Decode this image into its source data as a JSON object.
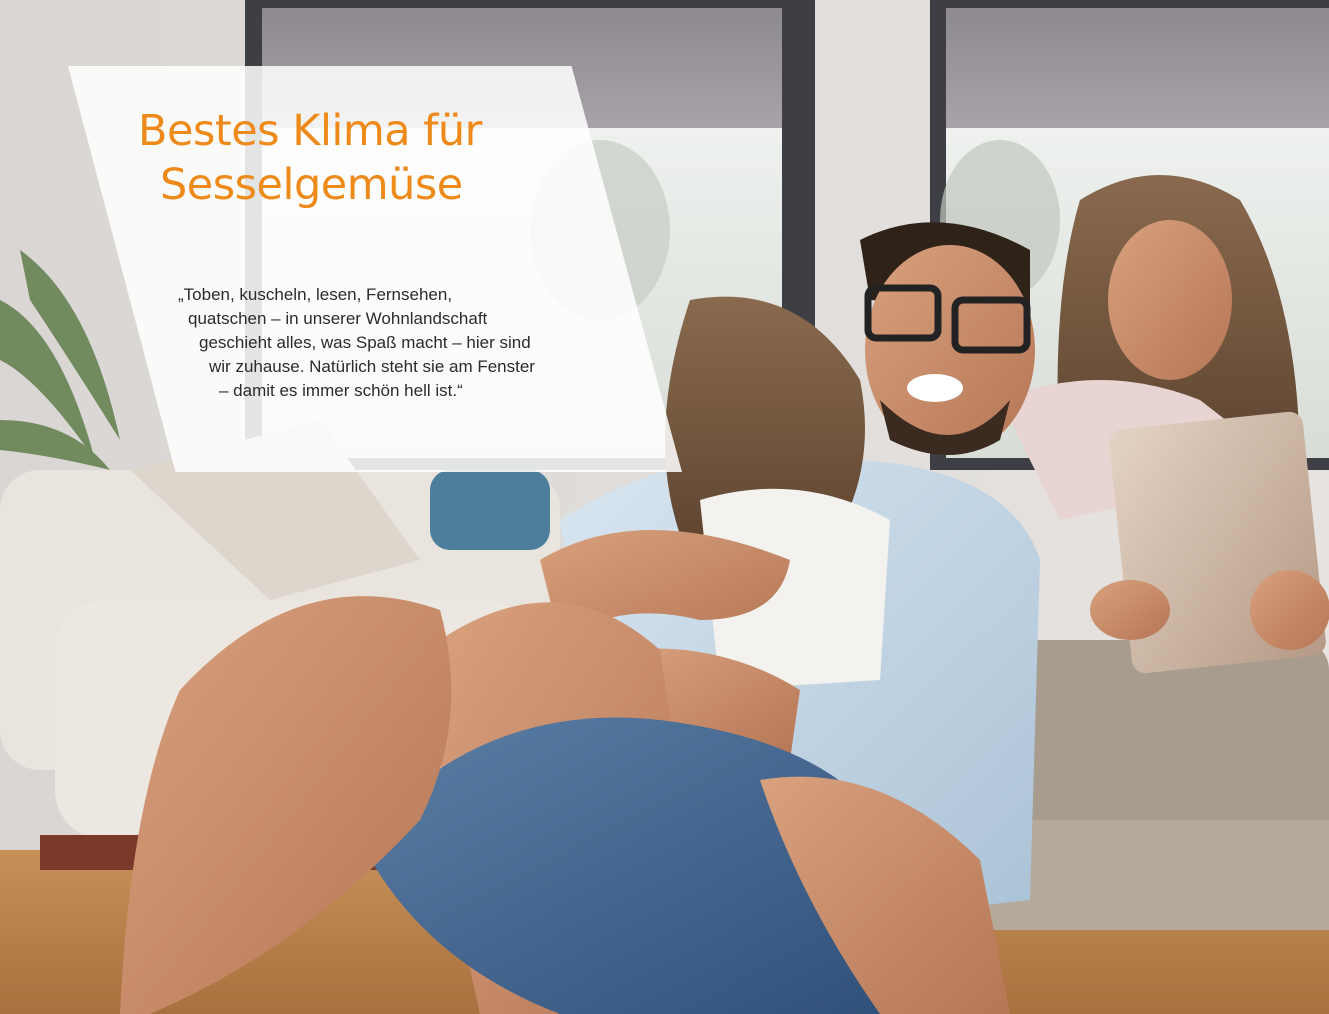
{
  "headline": {
    "line1": "Bestes Klima für",
    "line2": "Sesselgemüse"
  },
  "quote": {
    "lines": [
      "„Toben, kuscheln, lesen, Fernsehen,",
      "quatschen – in unserer Wohnlandschaft",
      "geschieht alles, was Spaß macht – hier sind",
      "wir zuhause. Natürlich steht sie am Fenster",
      "– damit es immer schön hell ist.“"
    ]
  },
  "colors": {
    "accent": "#ee8a1a",
    "text": "#2b2b2b"
  }
}
